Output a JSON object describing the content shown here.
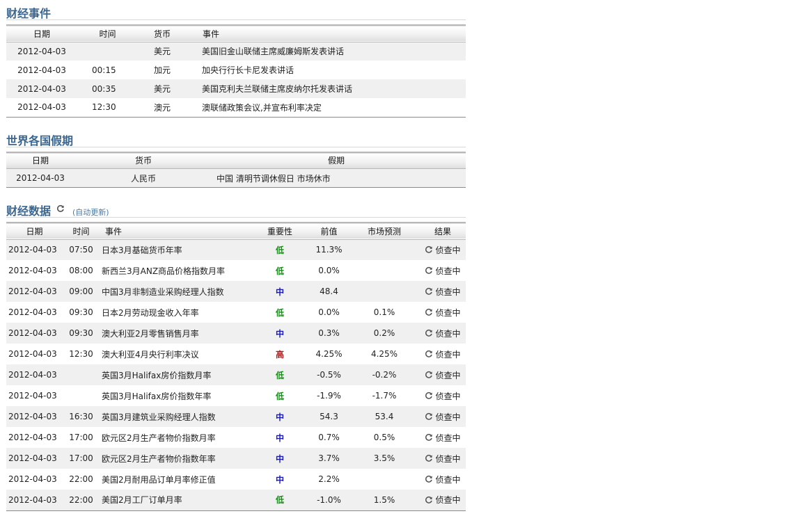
{
  "events": {
    "title": "财经事件",
    "columns": [
      "日期",
      "时间",
      "货币",
      "事件"
    ],
    "rows": [
      {
        "date": "2012-04-03",
        "time": "",
        "currency": "美元",
        "event": "美国旧金山联储主席威廉姆斯发表讲话"
      },
      {
        "date": "2012-04-03",
        "time": "00:15",
        "currency": "加元",
        "event": "加央行行长卡尼发表讲话"
      },
      {
        "date": "2012-04-03",
        "time": "00:35",
        "currency": "美元",
        "event": "美国克利夫兰联储主席皮纳尔托发表讲话"
      },
      {
        "date": "2012-04-03",
        "time": "12:30",
        "currency": "澳元",
        "event": "澳联储政策会议,并宣布利率决定"
      }
    ]
  },
  "holidays": {
    "title": "世界各国假期",
    "columns": [
      "日期",
      "货币",
      "假期"
    ],
    "rows": [
      {
        "date": "2012-04-03",
        "currency": "人民币",
        "holiday": "中国 清明节调休假日 市场休市"
      }
    ]
  },
  "financial_data": {
    "title": "财经数据",
    "auto_update": "(自动更新)",
    "refresh_icon": "refresh-icon",
    "columns": [
      "日期",
      "时间",
      "事件",
      "重要性",
      "前值",
      "市场预测",
      "结果"
    ],
    "importance_colors": {
      "低": "#1a8a1a",
      "中": "#1a1ab0",
      "高": "#b01a1a"
    },
    "rows": [
      {
        "date": "2012-04-03",
        "time": "07:50",
        "event": "日本3月基础货币年率",
        "importance": "低",
        "prev": "11.3%",
        "forecast": "",
        "result": "侦查中"
      },
      {
        "date": "2012-04-03",
        "time": "08:00",
        "event": "新西兰3月ANZ商品价格指数月率",
        "importance": "低",
        "prev": "0.0%",
        "forecast": "",
        "result": "侦查中"
      },
      {
        "date": "2012-04-03",
        "time": "09:00",
        "event": "中国3月非制造业采购经理人指数",
        "importance": "中",
        "prev": "48.4",
        "forecast": "",
        "result": "侦查中"
      },
      {
        "date": "2012-04-03",
        "time": "09:30",
        "event": "日本2月劳动现金收入年率",
        "importance": "低",
        "prev": "0.0%",
        "forecast": "0.1%",
        "result": "侦查中"
      },
      {
        "date": "2012-04-03",
        "time": "09:30",
        "event": "澳大利亚2月零售销售月率",
        "importance": "中",
        "prev": "0.3%",
        "forecast": "0.2%",
        "result": "侦查中"
      },
      {
        "date": "2012-04-03",
        "time": "12:30",
        "event": "澳大利亚4月央行利率决议",
        "importance": "高",
        "prev": "4.25%",
        "forecast": "4.25%",
        "result": "侦查中"
      },
      {
        "date": "2012-04-03",
        "time": "",
        "event": "英国3月Halifax房价指数月率",
        "importance": "低",
        "prev": "-0.5%",
        "forecast": "-0.2%",
        "result": "侦查中"
      },
      {
        "date": "2012-04-03",
        "time": "",
        "event": "英国3月Halifax房价指数年率",
        "importance": "低",
        "prev": "-1.9%",
        "forecast": "-1.7%",
        "result": "侦查中"
      },
      {
        "date": "2012-04-03",
        "time": "16:30",
        "event": "英国3月建筑业采购经理人指数",
        "importance": "中",
        "prev": "54.3",
        "forecast": "53.4",
        "result": "侦查中"
      },
      {
        "date": "2012-04-03",
        "time": "17:00",
        "event": "欧元区2月生产者物价指数月率",
        "importance": "中",
        "prev": "0.7%",
        "forecast": "0.5%",
        "result": "侦查中"
      },
      {
        "date": "2012-04-03",
        "time": "17:00",
        "event": "欧元区2月生产者物价指数年率",
        "importance": "中",
        "prev": "3.7%",
        "forecast": "3.5%",
        "result": "侦查中"
      },
      {
        "date": "2012-04-03",
        "time": "22:00",
        "event": "美国2月耐用品订单月率修正值",
        "importance": "中",
        "prev": "2.2%",
        "forecast": "",
        "result": "侦查中"
      },
      {
        "date": "2012-04-03",
        "time": "22:00",
        "event": "美国2月工厂订单月率",
        "importance": "低",
        "prev": "-1.0%",
        "forecast": "1.5%",
        "result": "侦查中"
      }
    ]
  }
}
